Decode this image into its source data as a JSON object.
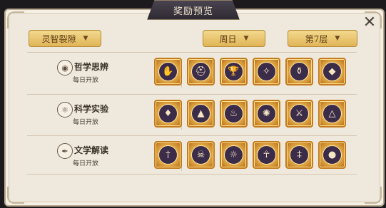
{
  "window": {
    "title": "奖励预览"
  },
  "filters": {
    "mode": "灵智裂隙",
    "day": "周日",
    "floor": "第7层"
  },
  "rows": [
    {
      "name": "哲学思辨",
      "sub": "每日开放",
      "icon": "eye-icon",
      "rewards": [
        "crystal-hand-icon",
        "winged-helmet-icon",
        "chalice-icon",
        "scarab-icon",
        "urn-icon",
        "purple-gem-icon"
      ]
    },
    {
      "name": "科学实验",
      "sub": "每日开放",
      "icon": "atom-icon",
      "rewards": [
        "green-crystal-icon",
        "pyramid-eye-icon",
        "flame-icon",
        "lion-head-icon",
        "crossed-swords-icon",
        "gold-triangle-icon"
      ]
    },
    {
      "name": "文学解读",
      "sub": "每日开放",
      "icon": "quill-icon",
      "rewards": [
        "sword-icon",
        "skull-icon",
        "winged-disc-icon",
        "ankh-icon",
        "dagger-icon",
        "orb-icon"
      ]
    }
  ]
}
